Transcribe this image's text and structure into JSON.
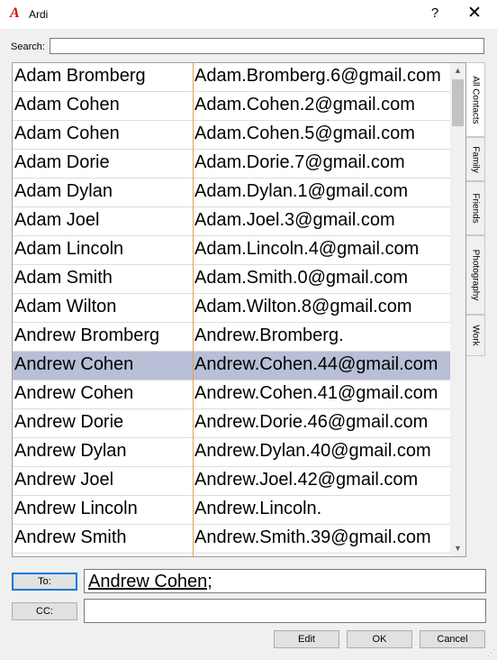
{
  "window": {
    "app_icon": "A",
    "title": "Ardi",
    "help_glyph": "?",
    "close_glyph": "✕"
  },
  "search": {
    "label": "Search:",
    "value": ""
  },
  "contacts": [
    {
      "name": "Adam Bromberg",
      "email": "Adam.Bromberg.6@gmail.com"
    },
    {
      "name": "Adam Cohen",
      "email": "Adam.Cohen.2@gmail.com"
    },
    {
      "name": "Adam Cohen",
      "email": "Adam.Cohen.5@gmail.com"
    },
    {
      "name": "Adam Dorie",
      "email": "Adam.Dorie.7@gmail.com"
    },
    {
      "name": "Adam Dylan",
      "email": "Adam.Dylan.1@gmail.com"
    },
    {
      "name": "Adam Joel",
      "email": "Adam.Joel.3@gmail.com"
    },
    {
      "name": "Adam Lincoln",
      "email": "Adam.Lincoln.4@gmail.com"
    },
    {
      "name": "Adam Smith",
      "email": "Adam.Smith.0@gmail.com"
    },
    {
      "name": "Adam Wilton",
      "email": "Adam.Wilton.8@gmail.com"
    },
    {
      "name": "Andrew Bromberg",
      "email": "Andrew.Bromberg."
    },
    {
      "name": "Andrew Cohen",
      "email": "Andrew.Cohen.44@gmail.com"
    },
    {
      "name": "Andrew Cohen",
      "email": "Andrew.Cohen.41@gmail.com"
    },
    {
      "name": "Andrew Dorie",
      "email": "Andrew.Dorie.46@gmail.com"
    },
    {
      "name": "Andrew Dylan",
      "email": "Andrew.Dylan.40@gmail.com"
    },
    {
      "name": "Andrew Joel",
      "email": "Andrew.Joel.42@gmail.com"
    },
    {
      "name": "Andrew Lincoln",
      "email": "Andrew.Lincoln."
    },
    {
      "name": "Andrew Smith",
      "email": "Andrew.Smith.39@gmail.com"
    }
  ],
  "selected_row": 10,
  "scrollbar": {
    "up_glyph": "▲",
    "down_glyph": "▼"
  },
  "tabs": [
    {
      "label": "All Contacts",
      "active": true
    },
    {
      "label": "Family",
      "active": false
    },
    {
      "label": "Friends",
      "active": false
    },
    {
      "label": "Photography",
      "active": false
    },
    {
      "label": "Work",
      "active": false
    }
  ],
  "to": {
    "button_label": "To:",
    "value": "Andrew Cohen;"
  },
  "cc": {
    "button_label": "CC:",
    "value": ""
  },
  "footer": {
    "edit_label": "Edit",
    "ok_label": "OK",
    "cancel_label": "Cancel"
  },
  "colors": {
    "selection": "#b8bfd6",
    "focus_border": "#0078d7",
    "column_separator": "#e0a050"
  }
}
